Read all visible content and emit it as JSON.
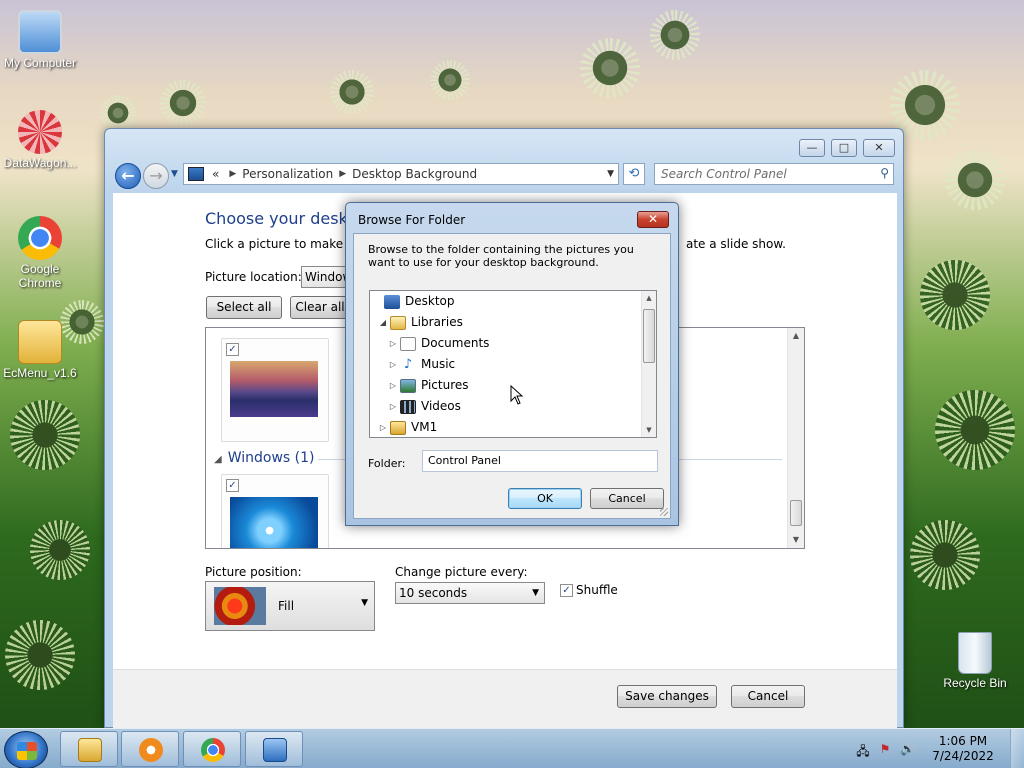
{
  "desktop": {
    "icons": [
      {
        "label": "My Computer"
      },
      {
        "label": "DataWagon..."
      },
      {
        "label": "Google Chrome"
      },
      {
        "label": "EcMenu_v1.6"
      },
      {
        "label": "Recycle Bin"
      }
    ]
  },
  "control_panel": {
    "window_buttons": {
      "minimize": "—",
      "maximize": "□",
      "close": "✕"
    },
    "address": {
      "prefix": "«",
      "crumbs": [
        "Personalization",
        "Desktop Background"
      ]
    },
    "search_placeholder": "Search Control Panel",
    "heading": "Choose your desktop",
    "subtitle_left": "Click a picture to make it y",
    "subtitle_right": "ate a slide show.",
    "picture_location_label": "Picture location:",
    "picture_location_value": "Window",
    "select_all": "Select all",
    "clear_all": "Clear all",
    "group_windows": "Windows (1)",
    "picture_position_label": "Picture position:",
    "picture_position_value": "Fill",
    "change_picture_label": "Change picture every:",
    "change_picture_value": "10 seconds",
    "shuffle_label": "Shuffle",
    "shuffle_checked": true,
    "save_changes": "Save changes",
    "cancel": "Cancel"
  },
  "dialog": {
    "title": "Browse For Folder",
    "close": "✕",
    "description": "Browse to the folder containing the pictures you want to use for your desktop background.",
    "tree": [
      {
        "label": "Desktop",
        "level": 0,
        "expander": "",
        "icon": "desktop-icon"
      },
      {
        "label": "Libraries",
        "level": 1,
        "expander": "◢",
        "icon": "libraries-icon"
      },
      {
        "label": "Documents",
        "level": 2,
        "expander": "▷",
        "icon": "documents-icon"
      },
      {
        "label": "Music",
        "level": 2,
        "expander": "▷",
        "icon": "music-icon"
      },
      {
        "label": "Pictures",
        "level": 2,
        "expander": "▷",
        "icon": "pictures-icon"
      },
      {
        "label": "Videos",
        "level": 2,
        "expander": "▷",
        "icon": "videos-icon"
      },
      {
        "label": "VM1",
        "level": 1,
        "expander": "▷",
        "icon": "user-folder-icon"
      }
    ],
    "folder_label": "Folder:",
    "folder_value": "Control Panel",
    "ok": "OK",
    "cancel": "Cancel"
  },
  "taskbar": {
    "clock_time": "1:06 PM",
    "clock_date": "7/24/2022"
  }
}
